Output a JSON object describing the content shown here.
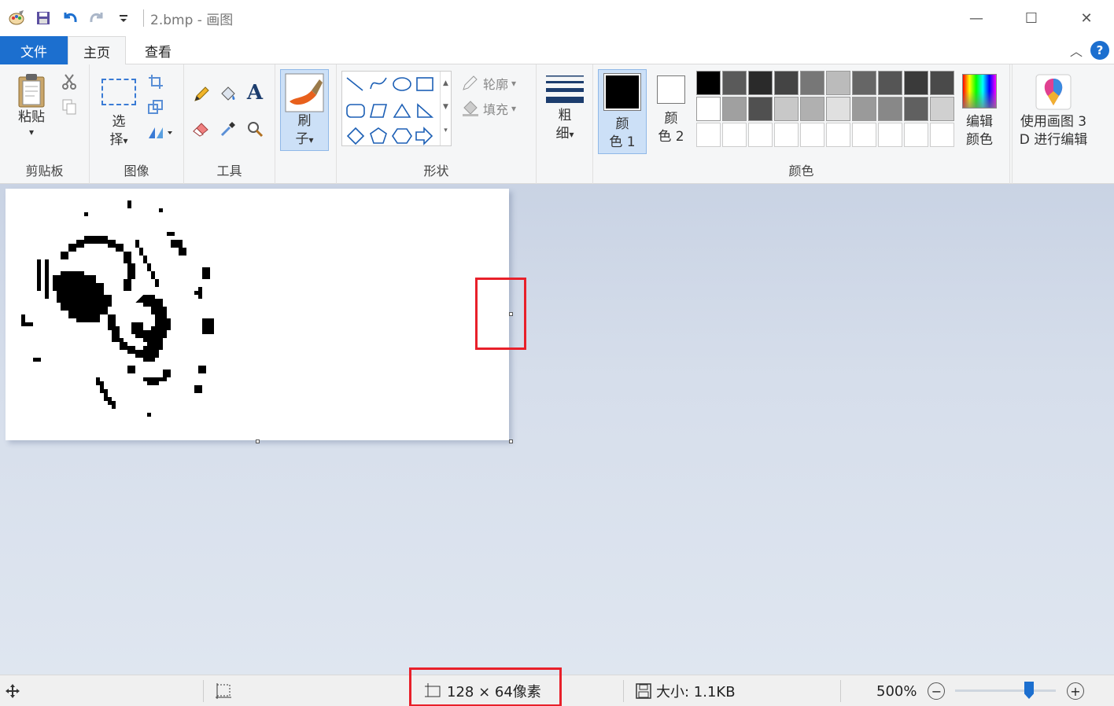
{
  "window": {
    "title": "2.bmp - 画图",
    "minimize_glyph": "—",
    "maximize_glyph": "☐",
    "close_glyph": "✕"
  },
  "tabs": {
    "file": "文件",
    "home": "主页",
    "view": "查看"
  },
  "help_glyph": "?",
  "collapse_glyph": "︿",
  "ribbon": {
    "clipboard": {
      "group": "剪贴板",
      "paste": "粘贴",
      "paste_arrow": "▾"
    },
    "image": {
      "group": "图像",
      "select_l1": "选",
      "select_l2": "择",
      "select_arrow": "▾"
    },
    "tools": {
      "group": "工具",
      "text_glyph": "A"
    },
    "brushes": {
      "l1": "刷",
      "l2": "子",
      "arrow": "▾"
    },
    "shapes": {
      "group": "形状",
      "outline": "轮廓",
      "fill": "填充",
      "arrow": "▾"
    },
    "size": {
      "l1": "粗",
      "l2": "细",
      "arrow": "▾"
    },
    "colors": {
      "group": "颜色",
      "color1_l1": "颜",
      "color1_l2": "色 1",
      "color2_l1": "颜",
      "color2_l2": "色 2",
      "edit_l1": "编辑",
      "edit_l2": "颜色",
      "color1": "#000000",
      "color2": "#ffffff"
    },
    "paint3d": {
      "l1": "使用画图 3",
      "l2": "D 进行编辑"
    }
  },
  "palette_row1": [
    "#000000",
    "#5a5a5a",
    "#2a2a2a",
    "#444444",
    "#777777",
    "#bbbbbb",
    "#666666",
    "#555555",
    "#3a3a3a",
    "#4a4a4a"
  ],
  "palette_row2": [
    "#ffffff",
    "#a0a0a0",
    "#505050",
    "#c8c8c8",
    "#b0b0b0",
    "#e0e0e0",
    "#9a9a9a",
    "#888888",
    "#606060",
    "#d0d0d0"
  ],
  "status": {
    "dimensions": "128 × 64像素",
    "filesize": "大小: 1.1KB",
    "zoom": "500%",
    "zoom_out": "−",
    "zoom_in": "+"
  },
  "colors": {
    "accent": "#1c6fcf",
    "highlight": "#e8202a"
  }
}
